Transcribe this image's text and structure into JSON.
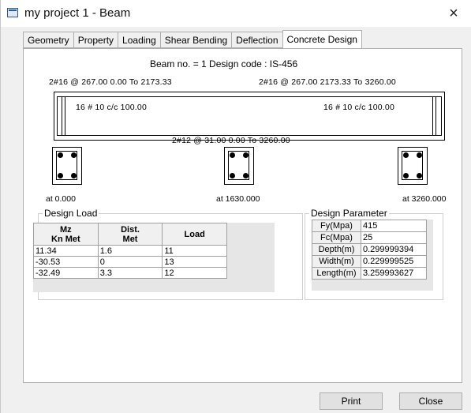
{
  "window": {
    "title": "my project 1 - Beam",
    "close_glyph": "×"
  },
  "tabs": [
    {
      "label": "Geometry"
    },
    {
      "label": "Property"
    },
    {
      "label": "Loading"
    },
    {
      "label": "Shear Bending"
    },
    {
      "label": "Deflection"
    },
    {
      "label": "Concrete Design",
      "active": true
    }
  ],
  "beam": {
    "info": "Beam no. = 1  Design code :  IS-456",
    "top_bar_left": "2#16 @ 267.00 0.00 To 2173.33",
    "top_bar_right": "2#16 @ 267.00 2173.33 To 3260.00",
    "stirrup_left": "16 # 10 c/c 100.00",
    "stirrup_right": "16 # 10 c/c 100.00",
    "bottom_bar": "2#12 @ 31.00 0.00 To 3260.00"
  },
  "sections": [
    {
      "label": "at 0.000"
    },
    {
      "label": "at 1630.000"
    },
    {
      "label": "at 3260.000"
    }
  ],
  "design_load": {
    "title": "Design Load",
    "headers": [
      "Mz\nKn Met",
      "Dist.\nMet",
      "Load"
    ],
    "header_lines": [
      [
        "Mz",
        "Kn Met"
      ],
      [
        "Dist.",
        "Met"
      ],
      [
        "Load"
      ]
    ],
    "rows": [
      [
        "11.34",
        "1.6",
        "11"
      ],
      [
        "-30.53",
        "0",
        "13"
      ],
      [
        "-32.49",
        "3.3",
        "12"
      ]
    ]
  },
  "design_parameter": {
    "title": "Design Parameter",
    "rows": [
      [
        "Fy(Mpa)",
        "415"
      ],
      [
        "Fc(Mpa)",
        "25"
      ],
      [
        "Depth(m)",
        "0.299999394"
      ],
      [
        "Width(m)",
        "0.229999525"
      ],
      [
        "Length(m)",
        "3.259993627"
      ]
    ]
  },
  "buttons": {
    "print": "Print",
    "close": "Close"
  }
}
